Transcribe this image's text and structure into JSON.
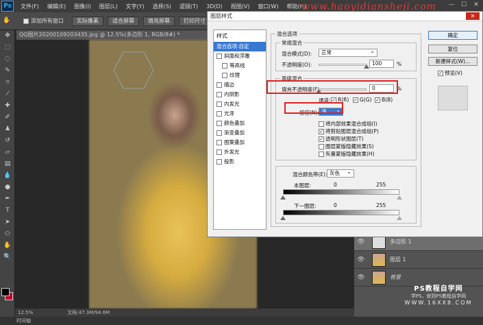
{
  "menubar": {
    "logo": "Ps",
    "items": [
      "文件(F)",
      "编辑(E)",
      "图像(I)",
      "图层(L)",
      "文字(Y)",
      "选择(S)",
      "滤镜(T)",
      "3D(D)",
      "视图(V)",
      "窗口(W)",
      "帮助(H)"
    ],
    "watermark": "www.haoyidiansheji.com"
  },
  "optionsbar": {
    "add_all_label": "添加所有窗口",
    "buttons": [
      "实际像素",
      "适合屏幕",
      "填充屏幕",
      "打印尺寸"
    ]
  },
  "document": {
    "tab_title": "QQ图片20200109203435.jpg @ 12.5%(多边形 1, RGB/8#) *",
    "zoom": "12.5%",
    "doc_info": "文档:47.3M/94.6M"
  },
  "timeline_label": "时间轴",
  "layers": {
    "items": [
      {
        "name": "多边形 1",
        "selected": true
      },
      {
        "name": "图层 1",
        "selected": false
      },
      {
        "name": "背景",
        "selected": false
      }
    ]
  },
  "brand": {
    "line1": "PS教程自学网",
    "line2": "学PS，就到PS教程自学网",
    "line3": "WWW.16XX8.COM"
  },
  "dialog": {
    "title": "图层样式",
    "close": "✕",
    "styles_header": "样式",
    "style_items": [
      {
        "label": "混合选项:自定",
        "selected": true,
        "checkbox": false,
        "sub": false
      },
      {
        "label": "斜面和浮雕",
        "checkbox": true,
        "sub": false
      },
      {
        "label": "等高线",
        "checkbox": true,
        "sub": true
      },
      {
        "label": "纹理",
        "checkbox": true,
        "sub": true
      },
      {
        "label": "描边",
        "checkbox": true,
        "sub": false
      },
      {
        "label": "内阴影",
        "checkbox": true,
        "sub": false
      },
      {
        "label": "内发光",
        "checkbox": true,
        "sub": false
      },
      {
        "label": "光泽",
        "checkbox": true,
        "sub": false
      },
      {
        "label": "颜色叠加",
        "checkbox": true,
        "sub": false
      },
      {
        "label": "渐变叠加",
        "checkbox": true,
        "sub": false
      },
      {
        "label": "图案叠加",
        "checkbox": true,
        "sub": false
      },
      {
        "label": "外发光",
        "checkbox": true,
        "sub": false
      },
      {
        "label": "投影",
        "checkbox": true,
        "sub": false
      }
    ],
    "blend_options_title": "混合选项",
    "general_title": "常规混合",
    "blend_mode_label": "混合模式(D):",
    "blend_mode_value": "正常",
    "opacity_label": "不透明度(O):",
    "opacity_value": "100",
    "opacity_unit": "%",
    "opacity_fraction": 1.0,
    "advanced_title": "高级混合",
    "fill_opacity_label": "填充不透明度(F):",
    "fill_opacity_value": "0",
    "fill_opacity_unit": "%",
    "fill_opacity_fraction": 0.0,
    "channels_label": "通道:",
    "channels": [
      "R(R)",
      "G(G)",
      "B(B)"
    ],
    "knockout_label": "挖空(N):",
    "knockout_value": "浅",
    "advanced_checks": [
      {
        "label": "将内部效果混合成组(I)",
        "checked": false
      },
      {
        "label": "将剪贴图层混合成组(P)",
        "checked": true
      },
      {
        "label": "透明形状图层(T)",
        "checked": true
      },
      {
        "label": "图层蒙版隐藏效果(S)",
        "checked": false
      },
      {
        "label": "矢量蒙版隐藏效果(H)",
        "checked": false
      }
    ],
    "blend_if_label": "混合颜色带(E):",
    "blend_if_value": "灰色",
    "this_layer_label": "本图层:",
    "underlying_label": "下一图层:",
    "range_min": "0",
    "range_max": "255",
    "buttons": {
      "ok": "确定",
      "reset": "复位",
      "new_style": "新建样式(W)...",
      "preview": "预览(V)"
    }
  }
}
